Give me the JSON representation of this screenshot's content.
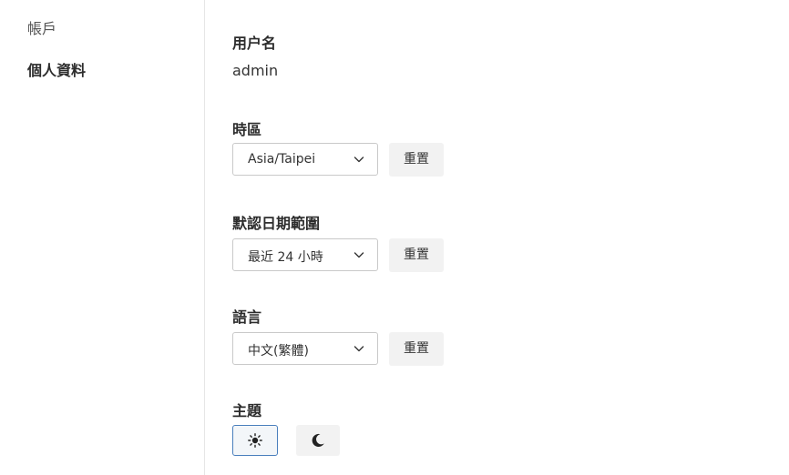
{
  "sidebar": {
    "items": [
      {
        "label": "帳戶"
      },
      {
        "label": "個人資料"
      }
    ]
  },
  "profile": {
    "username": {
      "label": "用户名",
      "value": "admin"
    },
    "timezone": {
      "label": "時區",
      "value": "Asia/Taipei",
      "reset_label": "重置"
    },
    "date_range": {
      "label": "默認日期範圍",
      "value": "最近 24 小時",
      "reset_label": "重置"
    },
    "language": {
      "label": "語言",
      "value": "中文(繁體)",
      "reset_label": "重置"
    },
    "theme": {
      "label": "主題",
      "options": [
        {
          "icon": "sun-icon",
          "selected": true
        },
        {
          "icon": "moon-icon",
          "selected": false
        }
      ]
    }
  },
  "colors": {
    "selected_border": "#4a7fbd",
    "button_bg": "#f2f2f2",
    "divider": "#e6e6e6"
  }
}
